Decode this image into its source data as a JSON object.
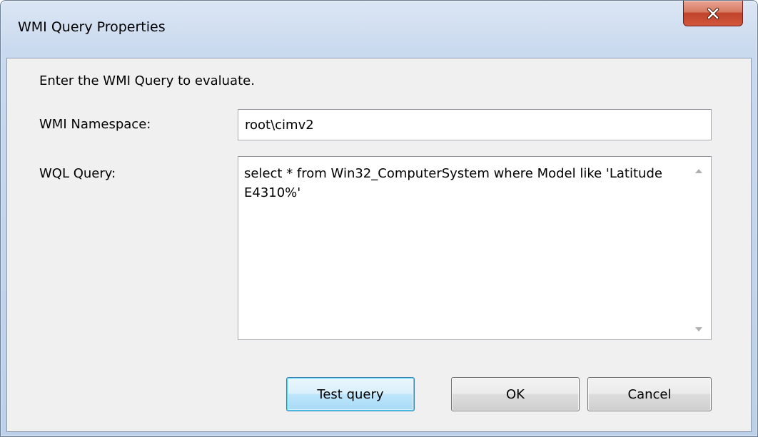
{
  "window": {
    "title": "WMI Query Properties"
  },
  "form": {
    "instruction": "Enter the WMI Query to evaluate.",
    "namespace_label": "WMI Namespace:",
    "namespace_value": "root\\cimv2",
    "query_label": "WQL Query:",
    "query_value": "select * from Win32_ComputerSystem where Model like 'Latitude E4310%'"
  },
  "buttons": {
    "test_label": "Test query",
    "ok_label": "OK",
    "cancel_label": "Cancel"
  },
  "icons": {
    "close": "close-icon",
    "scroll_up": "scroll-up-arrow-icon",
    "scroll_down": "scroll-down-arrow-icon"
  },
  "colors": {
    "close_button": "#c0432a",
    "frame": "#bcd0ea",
    "client": "#f0f0f0",
    "default_button_border": "#3c7fb1"
  }
}
